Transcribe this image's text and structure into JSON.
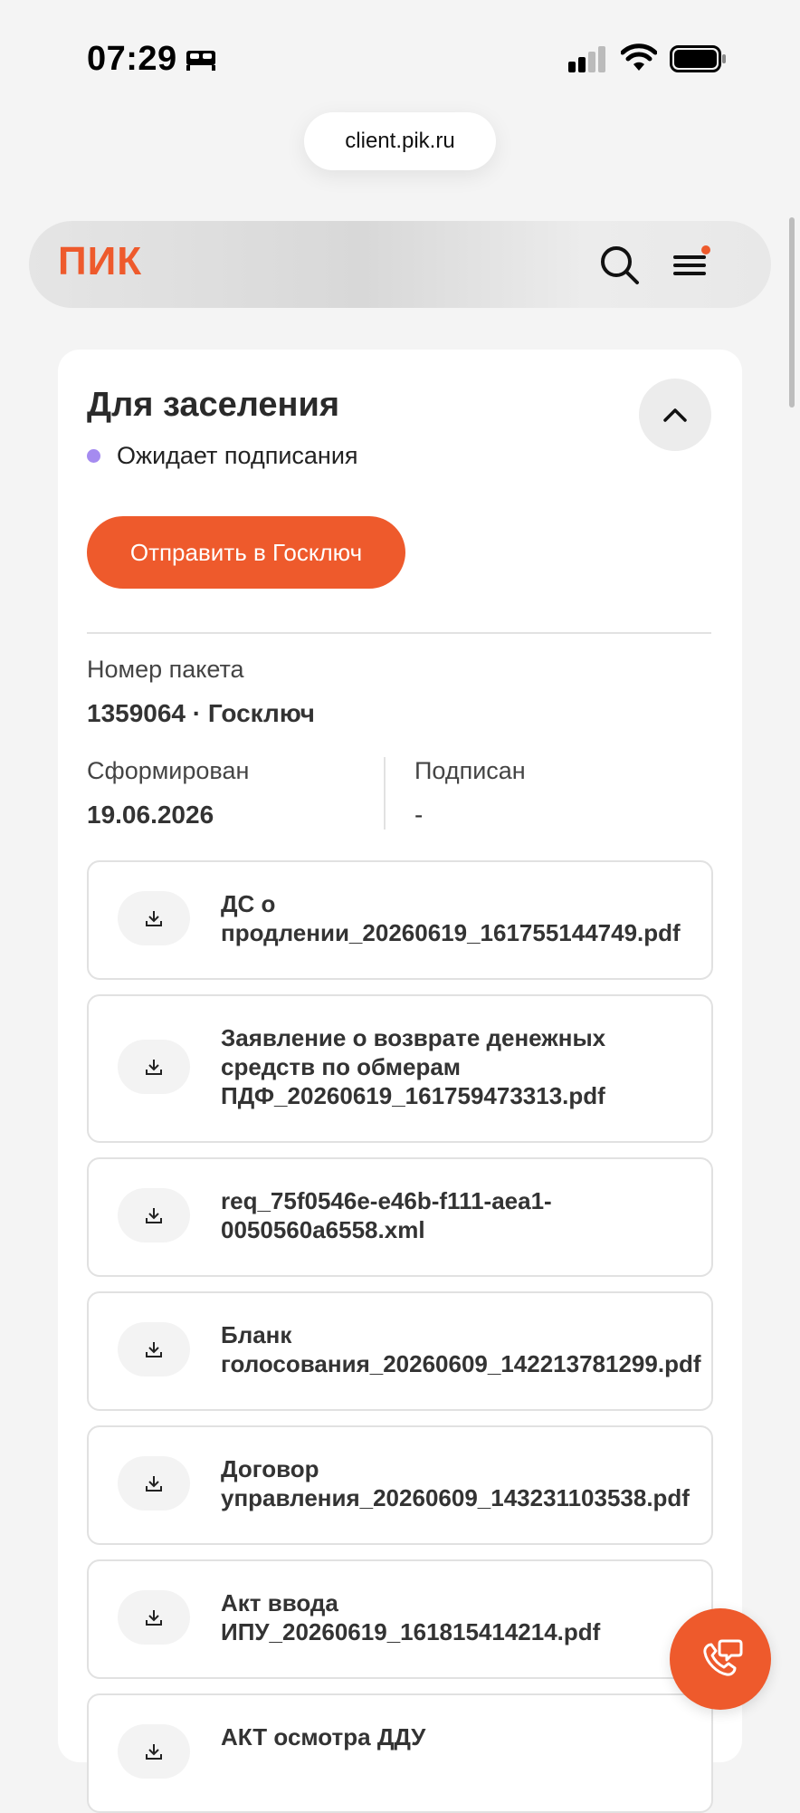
{
  "status_bar": {
    "time": "07:29"
  },
  "browser": {
    "url": "client.pik.ru"
  },
  "header": {
    "logo": "ПИК"
  },
  "card": {
    "title": "Для заселения",
    "status": "Ожидает подписания",
    "status_color": "#a58bf0",
    "send_button_label": "Отправить в Госключ",
    "package_number_label": "Номер пакета",
    "package_number_value": "1359064 · Госключ",
    "formed_label": "Сформирован",
    "formed_value": "19.06.2026",
    "signed_label": "Подписан",
    "signed_value": "-"
  },
  "files": [
    {
      "name": "ДС о\nпродлении_20260619_161755144749.pdf",
      "icon": "download-icon"
    },
    {
      "name": "Заявление о возврате денежных\nсредств по обмерам\nПДФ_20260619_161759473313.pdf",
      "icon": "download-icon"
    },
    {
      "name": "req_75f0546e-e46b-f111-aea1-\n0050560a6558.xml",
      "icon": "download-icon"
    },
    {
      "name": "Бланк\nголосования_20260609_142213781299.pdf",
      "icon": "download-icon"
    },
    {
      "name": "Договор\nуправления_20260609_143231103538.pdf",
      "icon": "download-icon"
    },
    {
      "name": "Акт ввода\nИПУ_20260619_161815414214.pdf",
      "icon": "download-icon"
    },
    {
      "name": "АКТ осмотра ДДУ",
      "icon": "download-icon"
    }
  ],
  "colors": {
    "accent": "#ee5a2c",
    "background": "#f4f4f4"
  }
}
